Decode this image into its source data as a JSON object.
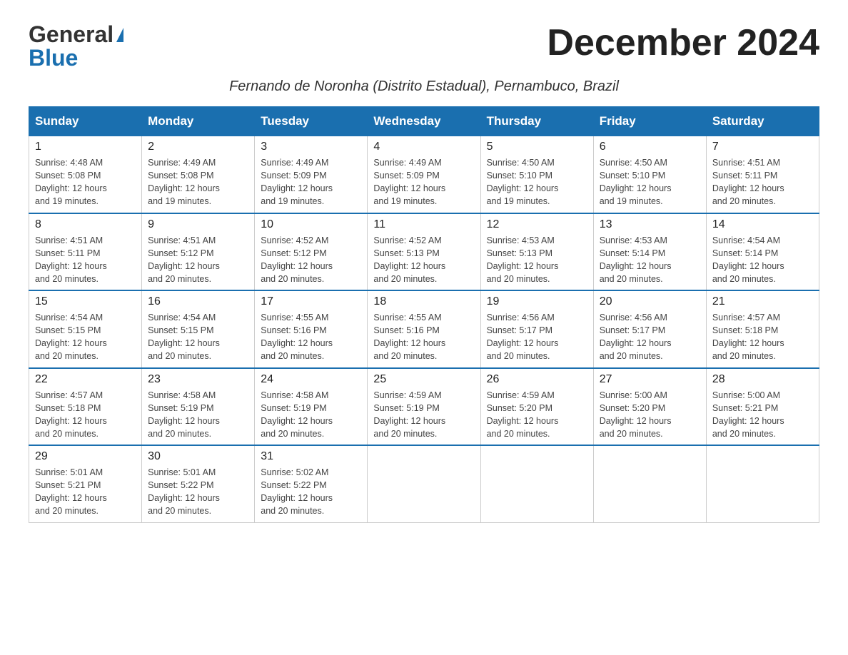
{
  "logo": {
    "general": "General",
    "blue": "Blue",
    "triangle": "▶"
  },
  "title": "December 2024",
  "subtitle": "Fernando de Noronha (Distrito Estadual), Pernambuco, Brazil",
  "days_of_week": [
    "Sunday",
    "Monday",
    "Tuesday",
    "Wednesday",
    "Thursday",
    "Friday",
    "Saturday"
  ],
  "weeks": [
    [
      {
        "day": "1",
        "sunrise": "4:48 AM",
        "sunset": "5:08 PM",
        "daylight": "12 hours and 19 minutes."
      },
      {
        "day": "2",
        "sunrise": "4:49 AM",
        "sunset": "5:08 PM",
        "daylight": "12 hours and 19 minutes."
      },
      {
        "day": "3",
        "sunrise": "4:49 AM",
        "sunset": "5:09 PM",
        "daylight": "12 hours and 19 minutes."
      },
      {
        "day": "4",
        "sunrise": "4:49 AM",
        "sunset": "5:09 PM",
        "daylight": "12 hours and 19 minutes."
      },
      {
        "day": "5",
        "sunrise": "4:50 AM",
        "sunset": "5:10 PM",
        "daylight": "12 hours and 19 minutes."
      },
      {
        "day": "6",
        "sunrise": "4:50 AM",
        "sunset": "5:10 PM",
        "daylight": "12 hours and 19 minutes."
      },
      {
        "day": "7",
        "sunrise": "4:51 AM",
        "sunset": "5:11 PM",
        "daylight": "12 hours and 20 minutes."
      }
    ],
    [
      {
        "day": "8",
        "sunrise": "4:51 AM",
        "sunset": "5:11 PM",
        "daylight": "12 hours and 20 minutes."
      },
      {
        "day": "9",
        "sunrise": "4:51 AM",
        "sunset": "5:12 PM",
        "daylight": "12 hours and 20 minutes."
      },
      {
        "day": "10",
        "sunrise": "4:52 AM",
        "sunset": "5:12 PM",
        "daylight": "12 hours and 20 minutes."
      },
      {
        "day": "11",
        "sunrise": "4:52 AM",
        "sunset": "5:13 PM",
        "daylight": "12 hours and 20 minutes."
      },
      {
        "day": "12",
        "sunrise": "4:53 AM",
        "sunset": "5:13 PM",
        "daylight": "12 hours and 20 minutes."
      },
      {
        "day": "13",
        "sunrise": "4:53 AM",
        "sunset": "5:14 PM",
        "daylight": "12 hours and 20 minutes."
      },
      {
        "day": "14",
        "sunrise": "4:54 AM",
        "sunset": "5:14 PM",
        "daylight": "12 hours and 20 minutes."
      }
    ],
    [
      {
        "day": "15",
        "sunrise": "4:54 AM",
        "sunset": "5:15 PM",
        "daylight": "12 hours and 20 minutes."
      },
      {
        "day": "16",
        "sunrise": "4:54 AM",
        "sunset": "5:15 PM",
        "daylight": "12 hours and 20 minutes."
      },
      {
        "day": "17",
        "sunrise": "4:55 AM",
        "sunset": "5:16 PM",
        "daylight": "12 hours and 20 minutes."
      },
      {
        "day": "18",
        "sunrise": "4:55 AM",
        "sunset": "5:16 PM",
        "daylight": "12 hours and 20 minutes."
      },
      {
        "day": "19",
        "sunrise": "4:56 AM",
        "sunset": "5:17 PM",
        "daylight": "12 hours and 20 minutes."
      },
      {
        "day": "20",
        "sunrise": "4:56 AM",
        "sunset": "5:17 PM",
        "daylight": "12 hours and 20 minutes."
      },
      {
        "day": "21",
        "sunrise": "4:57 AM",
        "sunset": "5:18 PM",
        "daylight": "12 hours and 20 minutes."
      }
    ],
    [
      {
        "day": "22",
        "sunrise": "4:57 AM",
        "sunset": "5:18 PM",
        "daylight": "12 hours and 20 minutes."
      },
      {
        "day": "23",
        "sunrise": "4:58 AM",
        "sunset": "5:19 PM",
        "daylight": "12 hours and 20 minutes."
      },
      {
        "day": "24",
        "sunrise": "4:58 AM",
        "sunset": "5:19 PM",
        "daylight": "12 hours and 20 minutes."
      },
      {
        "day": "25",
        "sunrise": "4:59 AM",
        "sunset": "5:19 PM",
        "daylight": "12 hours and 20 minutes."
      },
      {
        "day": "26",
        "sunrise": "4:59 AM",
        "sunset": "5:20 PM",
        "daylight": "12 hours and 20 minutes."
      },
      {
        "day": "27",
        "sunrise": "5:00 AM",
        "sunset": "5:20 PM",
        "daylight": "12 hours and 20 minutes."
      },
      {
        "day": "28",
        "sunrise": "5:00 AM",
        "sunset": "5:21 PM",
        "daylight": "12 hours and 20 minutes."
      }
    ],
    [
      {
        "day": "29",
        "sunrise": "5:01 AM",
        "sunset": "5:21 PM",
        "daylight": "12 hours and 20 minutes."
      },
      {
        "day": "30",
        "sunrise": "5:01 AM",
        "sunset": "5:22 PM",
        "daylight": "12 hours and 20 minutes."
      },
      {
        "day": "31",
        "sunrise": "5:02 AM",
        "sunset": "5:22 PM",
        "daylight": "12 hours and 20 minutes."
      },
      null,
      null,
      null,
      null
    ]
  ]
}
